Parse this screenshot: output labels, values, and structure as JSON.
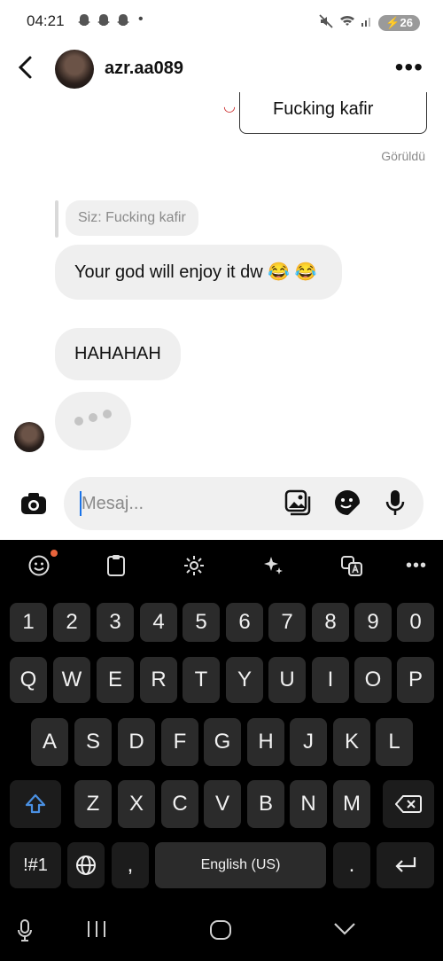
{
  "status_bar": {
    "time": "04:21",
    "snapchat_icons": [
      "ghost-icon",
      "ghost-icon",
      "ghost-icon"
    ],
    "dot": "•",
    "battery": "26"
  },
  "header": {
    "username": "azr.aa089",
    "more": "•••"
  },
  "chat": {
    "sticker_text": "Fucking kafir",
    "seen_label": "Görüldü",
    "reply_preview": "Siz: Fucking kafir",
    "messages": [
      {
        "text": "Your god will enjoy it dw 😂 😂"
      },
      {
        "text": "HAHAHAH"
      }
    ]
  },
  "composer": {
    "placeholder": "Mesaj..."
  },
  "keyboard": {
    "number_row": [
      "1",
      "2",
      "3",
      "4",
      "5",
      "6",
      "7",
      "8",
      "9",
      "0"
    ],
    "row_q": [
      "Q",
      "W",
      "E",
      "R",
      "T",
      "Y",
      "U",
      "I",
      "O",
      "P"
    ],
    "row_a": [
      "A",
      "S",
      "D",
      "F",
      "G",
      "H",
      "J",
      "K",
      "L"
    ],
    "row_z": [
      "Z",
      "X",
      "C",
      "V",
      "B",
      "N",
      "M"
    ],
    "symbols": "!#1",
    "comma": ",",
    "space": "English (US)",
    "period": "."
  },
  "colors": {
    "bubble": "#efefef",
    "keyboard_bg": "#000000",
    "key_bg": "#2b2b2b",
    "caret": "#1a73e8",
    "notify_dot": "#e8643c"
  }
}
